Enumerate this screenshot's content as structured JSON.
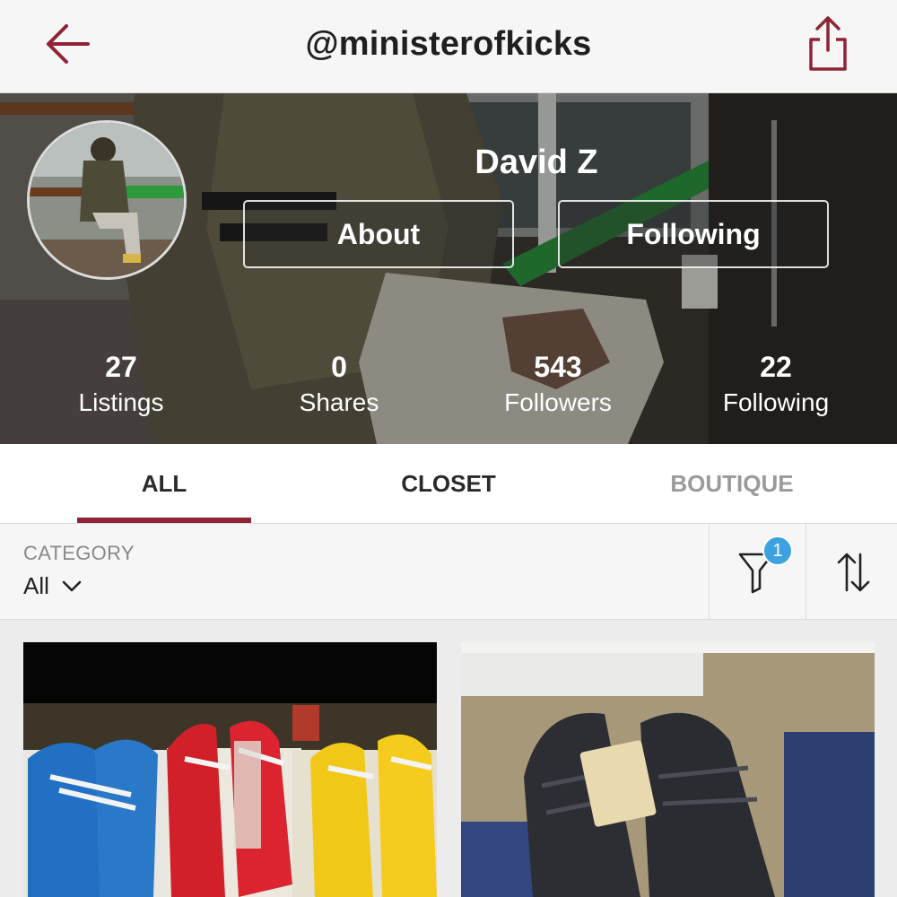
{
  "header": {
    "title": "@ministerofkicks",
    "back_icon": "arrow-left-icon",
    "share_icon": "share-icon",
    "accent_color": "#8e2436"
  },
  "profile": {
    "name": "David Z",
    "about_label": "About",
    "following_label": "Following",
    "stats": [
      {
        "value": "27",
        "label": "Listings"
      },
      {
        "value": "0",
        "label": "Shares"
      },
      {
        "value": "543",
        "label": "Followers"
      },
      {
        "value": "22",
        "label": "Following"
      }
    ]
  },
  "tabs": [
    {
      "label": "ALL",
      "active": true
    },
    {
      "label": "CLOSET",
      "active": false
    },
    {
      "label": "BOUTIQUE",
      "active": false
    }
  ],
  "filter": {
    "category_label": "CATEGORY",
    "category_value": "All",
    "filter_count": "1",
    "filter_icon": "filter-funnel-icon",
    "sort_icon": "sort-arrows-icon",
    "badge_color": "#3da2e0"
  },
  "listings": [
    {
      "image": "sneakers-photo-colorful"
    },
    {
      "image": "sneakers-photo-black"
    }
  ]
}
